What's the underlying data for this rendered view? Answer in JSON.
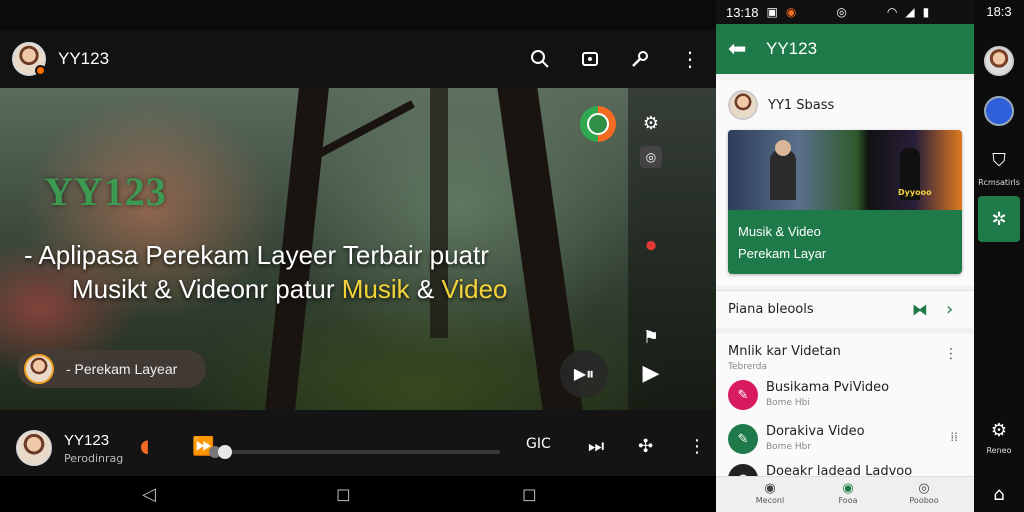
{
  "player": {
    "channel": "YY123",
    "video_logo": "YY123",
    "headline_line1": "- Aplipasa Perekam Layeer Terbair puatr",
    "headline_line2_prefix": "Musikt & Videonr patur ",
    "headline_hl1": "Musik",
    "headline_mid": " & ",
    "headline_hl2": "Video",
    "chip_label": "- Perekam Layear",
    "bottom_name": "YY123",
    "bottom_sub": "Perodinrag",
    "quality_label": "GIC",
    "progress": 0.04,
    "icons": {
      "search": "search-icon",
      "cast": "cast-icon",
      "settings": "wrench-icon",
      "more": "more-vert-icon"
    }
  },
  "app": {
    "status_time": "13:18",
    "title": "YY123",
    "card_user": "YY1 Sbass",
    "thumb_line1": "Musik & Video",
    "thumb_line2": "Perekam Layar",
    "thumb_tag": "Dyyooo",
    "section_label": "Piana bleools",
    "list_header": "Mnlik kar Videtan",
    "list_subheader": "Tebrerda",
    "items": [
      {
        "title": "Busikama PviVideo",
        "sub": "Bome Hbi",
        "color": "#d81b60"
      },
      {
        "title": "Dorakiva Video",
        "sub": "Bome Hbr",
        "color": "#1e7a48"
      },
      {
        "title": "Doeakr ladead Ladvoo",
        "sub": "",
        "color": "#222222"
      }
    ],
    "bottom_nav": [
      "Meconl",
      "Fooa",
      "Pooboo"
    ]
  },
  "rail": {
    "clock": "18:3",
    "label1": "Rcmsatirls",
    "label2": "Reneo"
  },
  "colors": {
    "brand_green": "#1e7a48",
    "highlight_yellow": "#f3d23a",
    "record_red": "#e53935"
  }
}
